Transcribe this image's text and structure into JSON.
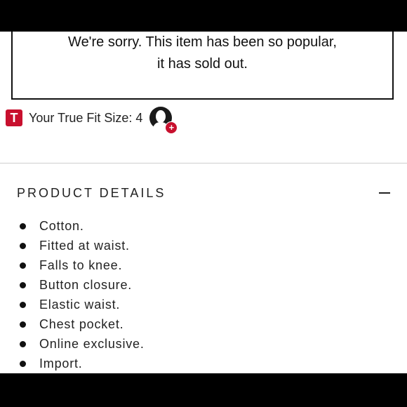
{
  "soldout": {
    "line1": "We're sorry. This item has been so popular,",
    "line2": "it has sold out."
  },
  "truefit": {
    "logo_letter": "T",
    "label": "Your True Fit Size: 4",
    "avatar_icon": "user-avatar-icon",
    "badge_symbol": "+"
  },
  "product_details": {
    "title": "PRODUCT DETAILS",
    "toggle_icon": "minus-icon",
    "items": [
      "Cotton.",
      "Fitted at waist.",
      "Falls to knee.",
      "Button closure.",
      "Elastic waist.",
      "Chest pocket.",
      "Online exclusive.",
      "Import."
    ]
  },
  "colors": {
    "brand_red": "#c8102e",
    "text": "#222222",
    "letterbox": "#000000"
  }
}
